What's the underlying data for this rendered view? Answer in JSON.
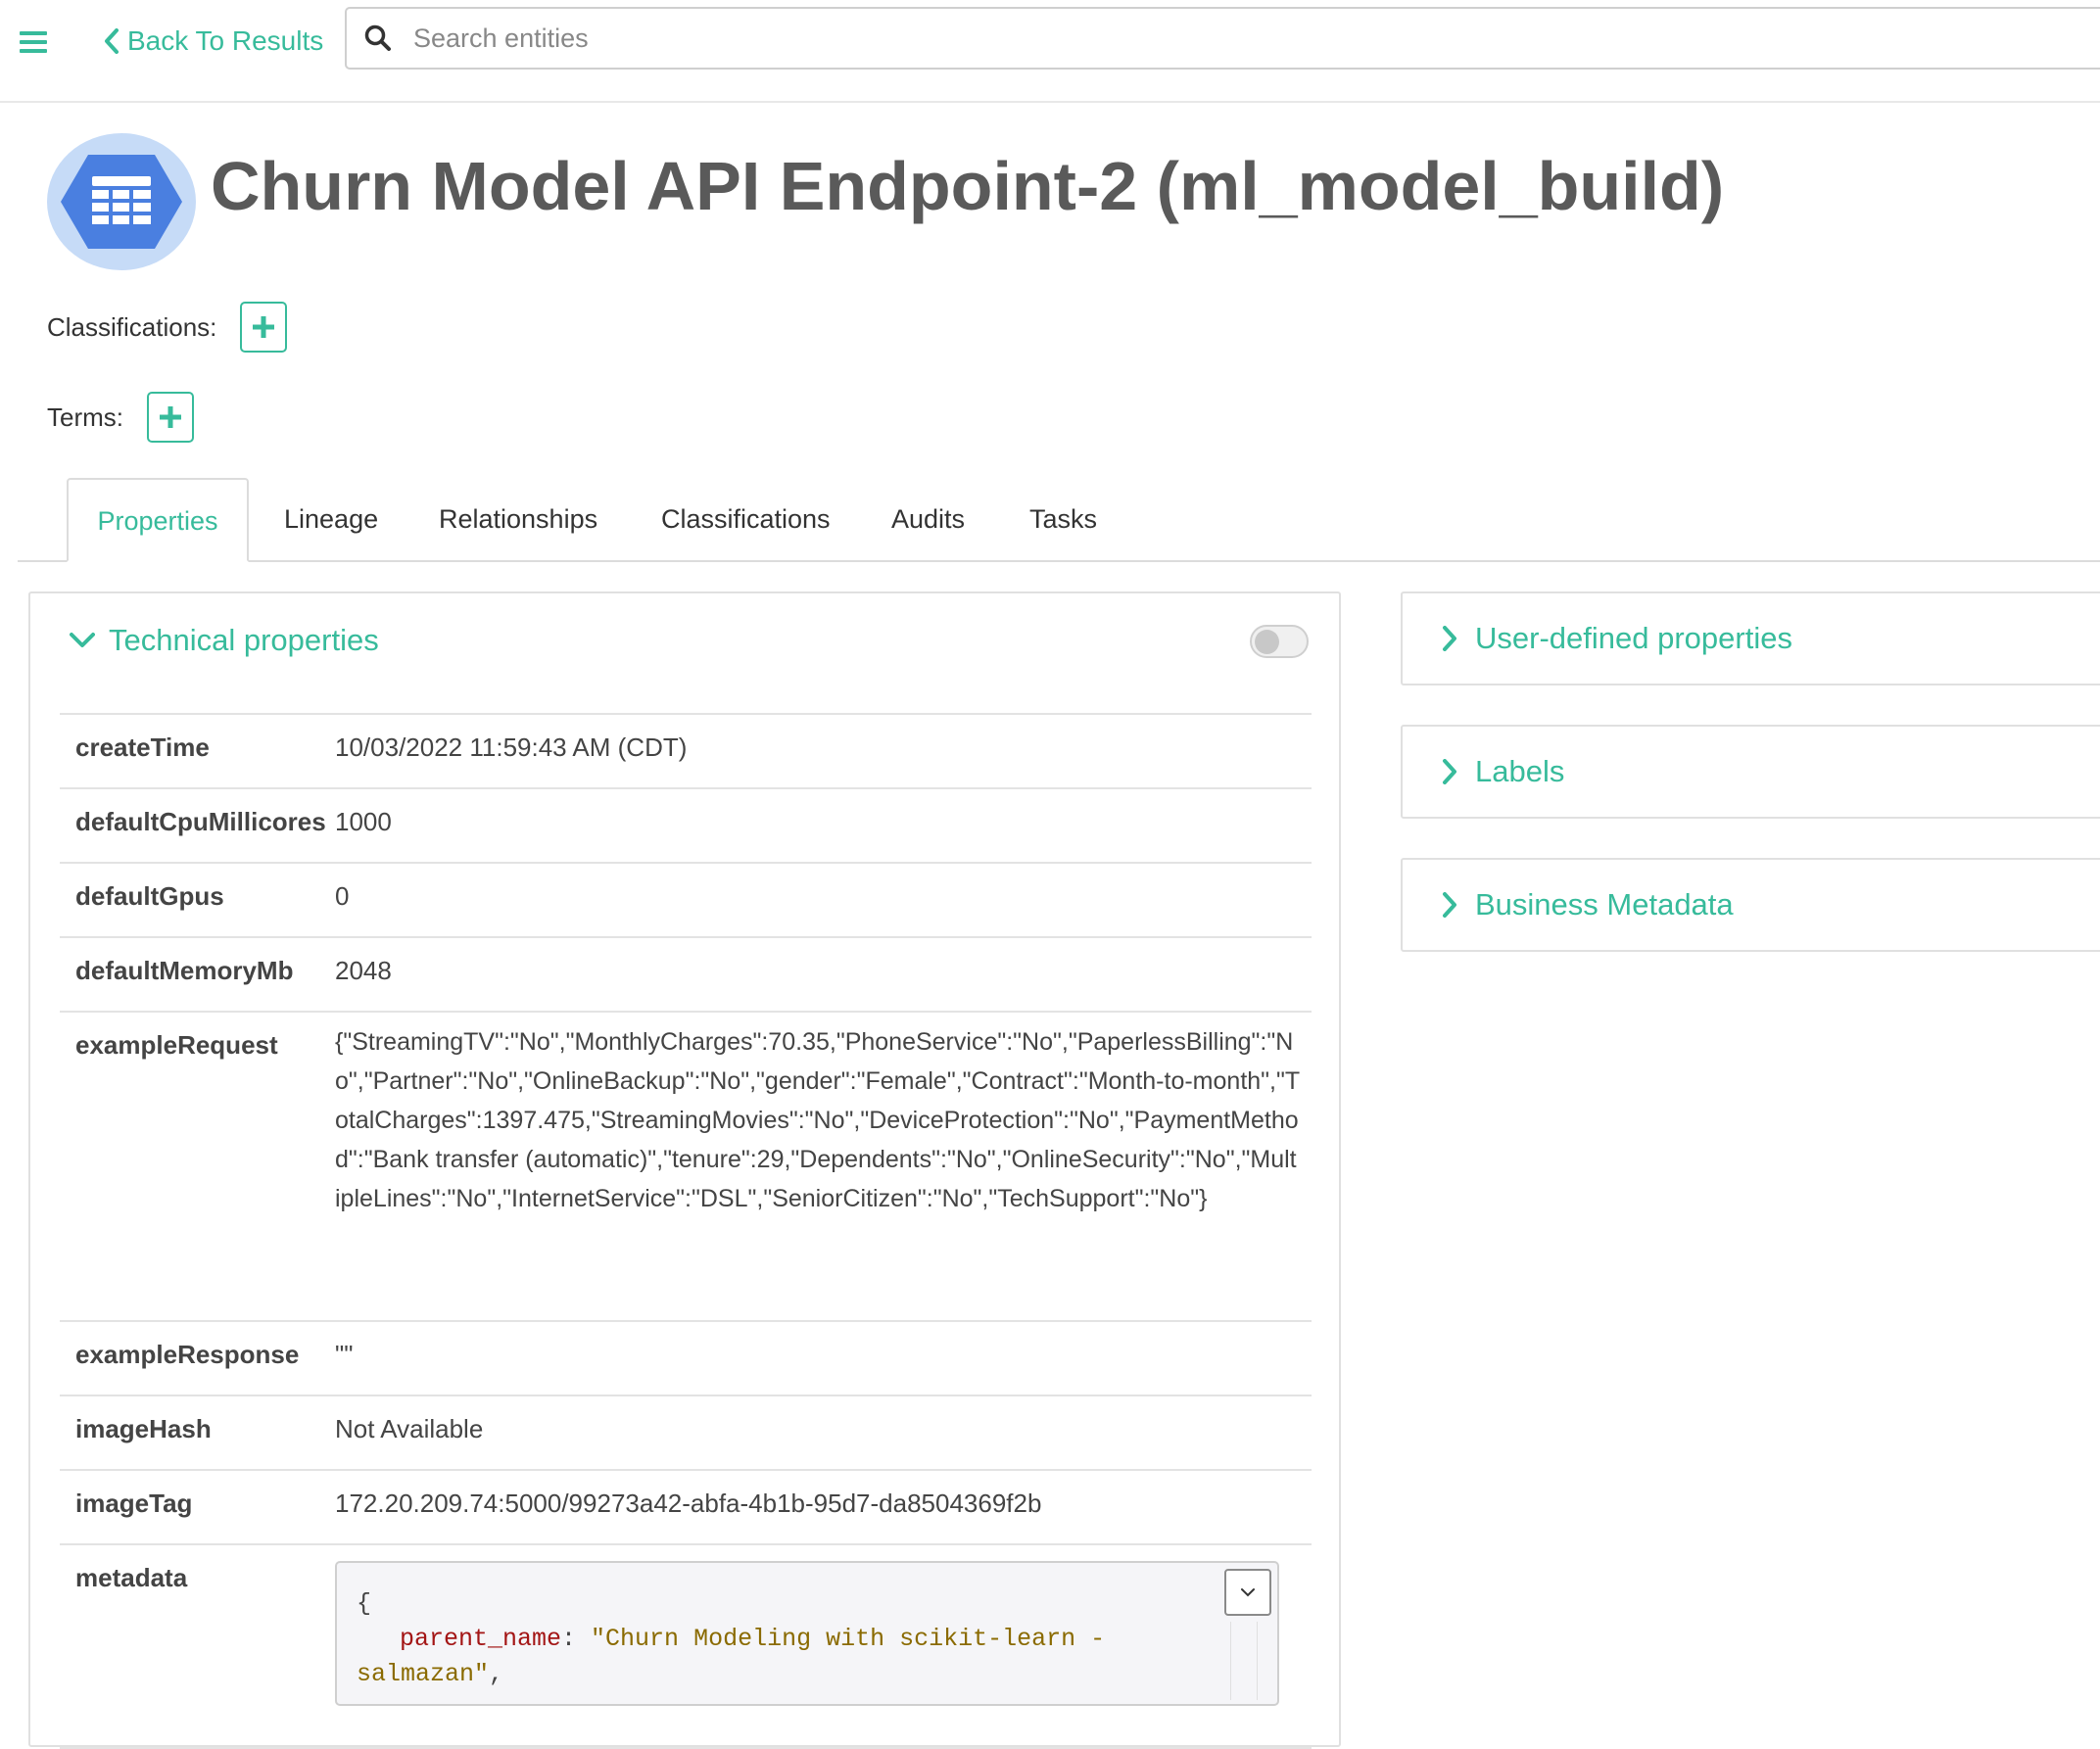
{
  "nav": {
    "back_label": "Back To Results",
    "search_placeholder": "Search entities"
  },
  "entity": {
    "title": "Churn Model API Endpoint-2 (ml_model_build)",
    "icon": "table-grid-icon"
  },
  "classifications_label": "Classifications:",
  "terms_label": "Terms:",
  "tabs": [
    {
      "label": "Properties",
      "active": true
    },
    {
      "label": "Lineage",
      "active": false
    },
    {
      "label": "Relationships",
      "active": false
    },
    {
      "label": "Classifications",
      "active": false
    },
    {
      "label": "Audits",
      "active": false
    },
    {
      "label": "Tasks",
      "active": false
    }
  ],
  "technical": {
    "title": "Technical properties",
    "toggle_on": false,
    "properties": [
      {
        "key": "createTime",
        "value": "10/03/2022 11:59:43 AM (CDT)"
      },
      {
        "key": "defaultCpuMillicores",
        "value": "1000"
      },
      {
        "key": "defaultGpus",
        "value": "0"
      },
      {
        "key": "defaultMemoryMb",
        "value": "2048"
      },
      {
        "key": "exampleRequest",
        "value": "{\"StreamingTV\":\"No\",\"MonthlyCharges\":70.35,\"PhoneService\":\"No\",\"PaperlessBilling\":\"No\",\"Partner\":\"No\",\"OnlineBackup\":\"No\",\"gender\":\"Female\",\"Contract\":\"Month-to-month\",\"TotalCharges\":1397.475,\"StreamingMovies\":\"No\",\"DeviceProtection\":\"No\",\"PaymentMethod\":\"Bank transfer (automatic)\",\"tenure\":29,\"Dependents\":\"No\",\"OnlineSecurity\":\"No\",\"MultipleLines\":\"No\",\"InternetService\":\"DSL\",\"SeniorCitizen\":\"No\",\"TechSupport\":\"No\"}"
      },
      {
        "key": "exampleResponse",
        "value": "\"\""
      },
      {
        "key": "imageHash",
        "value": "Not Available"
      },
      {
        "key": "imageTag",
        "value": "172.20.209.74:5000/99273a42-abfa-4b1b-95d7-da8504369f2b"
      },
      {
        "key": "metadata",
        "value": ""
      }
    ],
    "metadata_code": {
      "open_brace": "{",
      "key": "parent_name",
      "colon": ": ",
      "value_line1": "\"Churn Modeling with scikit-learn -",
      "value_line2": "salmazan\"",
      "trailing": ","
    }
  },
  "right_panels": [
    {
      "label": "User-defined properties"
    },
    {
      "label": "Labels"
    },
    {
      "label": "Business Metadata"
    }
  ],
  "colors": {
    "accent": "#37bb9b",
    "icon_bg": "#c6dbf7",
    "icon_fg": "#4a7fe0"
  }
}
